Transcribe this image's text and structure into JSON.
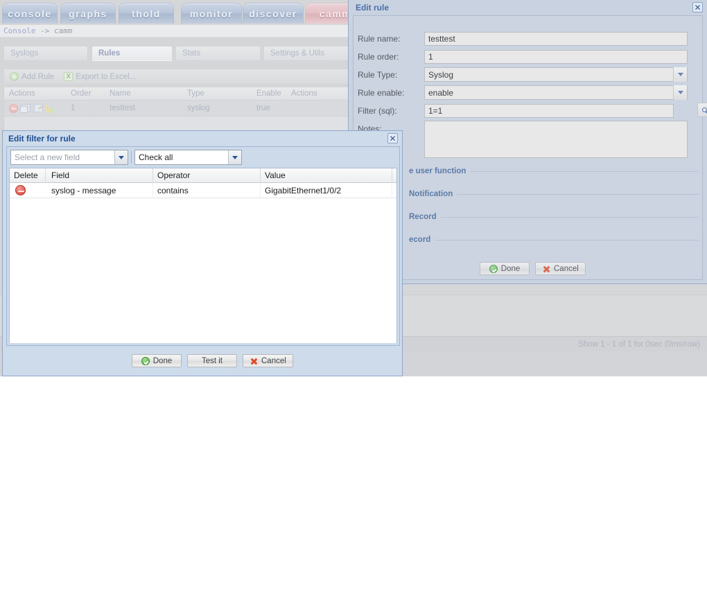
{
  "app": {
    "main_tabs": [
      {
        "label": "console",
        "accent": false
      },
      {
        "label": "graphs",
        "accent": false
      },
      {
        "label": "thold",
        "accent": false
      },
      {
        "label": "monitor",
        "accent": false
      },
      {
        "label": "discover",
        "accent": false
      },
      {
        "label": "camm",
        "accent": true
      }
    ],
    "breadcrumb": {
      "root": "Console",
      "sep": " -> ",
      "current": "camm"
    },
    "sub_tabs": [
      {
        "label": "Syslogs",
        "active": false
      },
      {
        "label": "Rules",
        "active": true
      },
      {
        "label": "Stats",
        "active": false
      },
      {
        "label": "Settings & Utils",
        "active": false
      }
    ],
    "toolbar": {
      "add_rule_label": "Add Rule",
      "export_label": "Export to Excel...",
      "excel_glyph": "X"
    },
    "table": {
      "headers": [
        "Actions",
        "Order",
        "Name",
        "Type",
        "Enable",
        "Actions"
      ],
      "rows": [
        {
          "order": "1",
          "name": "testtest",
          "type": "syslog",
          "enable": "true"
        }
      ]
    },
    "status_text": "Show 1 - 1 of 1 for 0sec (0ms/row)"
  },
  "edit_rule": {
    "title": "Edit rule",
    "close_glyph": "✕",
    "fields": [
      {
        "label": "Rule name:",
        "value": "testtest",
        "kind": "text"
      },
      {
        "label": "Rule order:",
        "value": "1",
        "kind": "text"
      },
      {
        "label": "Rule Type:",
        "value": "Syslog",
        "kind": "select"
      },
      {
        "label": "Rule enable:",
        "value": "enable",
        "kind": "select"
      },
      {
        "label": "Filter (sql):",
        "value": "1=1",
        "kind": "search"
      },
      {
        "label": "Notes:",
        "value": "",
        "kind": "textarea"
      }
    ],
    "sections": [
      {
        "label": "e user function"
      },
      {
        "label": "Notification"
      },
      {
        "label": "Record"
      },
      {
        "label": "ecord"
      }
    ],
    "buttons": [
      {
        "label": "Done",
        "icon": "check-circle-icon"
      },
      {
        "label": "Cancel",
        "icon": "x-mark-icon"
      }
    ]
  },
  "edit_filter": {
    "title": "Edit filter for rule",
    "close_glyph": "✕",
    "field_select": {
      "value": "Select a new field",
      "is_placeholder": true
    },
    "check_select": {
      "value": "Check all",
      "is_placeholder": false
    },
    "table": {
      "headers": [
        "Delete",
        "Field",
        "Operator",
        "Value"
      ],
      "rows": [
        {
          "field": "syslog - message",
          "operator": "contains",
          "value": "GigabitEthernet1/0/2"
        }
      ]
    },
    "buttons": [
      {
        "label": "Done",
        "icon": "check-circle-icon"
      },
      {
        "label": "Test it",
        "icon": "none"
      },
      {
        "label": "Cancel",
        "icon": "x-mark-icon"
      }
    ]
  }
}
